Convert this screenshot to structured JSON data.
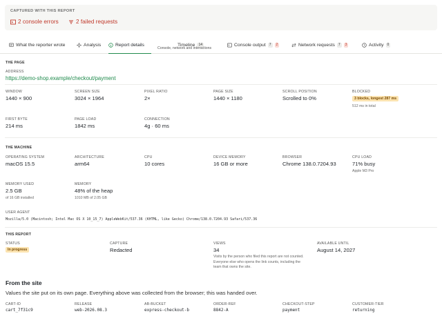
{
  "alert": {
    "title": "CAPTURED WITH THIS REPORT",
    "console_errors": "2 console errors",
    "failed_requests": "2 failed requests"
  },
  "tabs": [
    {
      "label": "What the reporter wrote",
      "icon": "message-icon"
    },
    {
      "label": "Analysis",
      "icon": "sparkle-icon"
    },
    {
      "label": "Report details",
      "icon": "info-icon",
      "active": true
    },
    {
      "label": "Timeline",
      "count": "14",
      "sub": "Console, network and interactions"
    },
    {
      "label": "Console output",
      "count": "7",
      "count_red": "2",
      "icon": "terminal-icon"
    },
    {
      "label": "Network requests",
      "count": "7",
      "count_red": "3",
      "icon": "network-icon"
    },
    {
      "label": "Activity",
      "count": "0",
      "icon": "activity-icon"
    }
  ],
  "page": {
    "section": "THE PAGE",
    "address_label": "ADDRESS",
    "address": "https://demo-shop.example/checkout/payment",
    "window_label": "WINDOW",
    "window": "1440 × 900",
    "screen_label": "SCREEN SIZE",
    "screen": "3024 × 1964",
    "pixel_label": "PIXEL RATIO",
    "pixel": "2×",
    "pagesize_label": "PAGE SIZE",
    "pagesize": "1440 × 1180",
    "scroll_label": "SCROLL POSITION",
    "scroll": "Scrolled to 0%",
    "blocked_label": "BLOCKED",
    "blocked_badge": "3 blocks, longest 287 ms",
    "blocked_sub": "512 ms in total",
    "firstbyte_label": "FIRST BYTE",
    "firstbyte": "214 ms",
    "pageload_label": "PAGE LOAD",
    "pageload": "1842 ms",
    "connection_label": "CONNECTION",
    "connection": "4g · 60 ms"
  },
  "machine": {
    "section": "THE MACHINE",
    "os_label": "OPERATING SYSTEM",
    "os": "macOS 15.5",
    "arch_label": "ARCHITECTURE",
    "arch": "arm64",
    "cpu_label": "CPU",
    "cpu": "10 cores",
    "devmem_label": "DEVICE MEMORY",
    "devmem": "16 GB or more",
    "browser_label": "BROWSER",
    "browser": "Chrome 138.0.7204.93",
    "cpuload_label": "CPU LOAD",
    "cpuload": "71% busy",
    "cpuload_sub": "Apple M3 Pro",
    "memused_label": "MEMORY USED",
    "memused": "2.5 GB",
    "memused_sub": "of 16 GB installed",
    "memory_label": "MEMORY",
    "memory": "48% of the heap",
    "memory_sub": "1010 MB of 2.05 GB",
    "ua_label": "USER AGENT",
    "ua": "Mozilla/5.0 (Macintosh; Intel Mac OS X 10_15_7) AppleWebKit/537.36 (KHTML, like Gecko) Chrome/138.0.7204.93 Safari/537.36"
  },
  "report": {
    "section": "THIS REPORT",
    "status_label": "STATUS",
    "status": "In progress",
    "capture_label": "CAPTURE",
    "capture": "Redacted",
    "views_label": "VIEWS",
    "views": "34",
    "views_note": "Visits by the person who filed this report are not counted. Everyone else who opens the link counts, including the team that owns the site.",
    "available_label": "AVAILABLE UNTIL",
    "available": "August 14, 2027"
  },
  "site": {
    "heading": "From the site",
    "desc": "Values the site put on its own page. Everything above was collected from the browser; this was handed over.",
    "fields": [
      {
        "label": "CART-ID",
        "value": "cart_7f31c9"
      },
      {
        "label": "RELEASE",
        "value": "web-2026.08.3"
      },
      {
        "label": "AB-BUCKET",
        "value": "express-checkout-b"
      },
      {
        "label": "ORDER-REF",
        "value": "8842-A"
      },
      {
        "label": "CHECKOUT-STEP",
        "value": "payment"
      },
      {
        "label": "CUSTOMER-TIER",
        "value": "returning"
      }
    ]
  },
  "colors": {
    "accent": "#1f8a4c",
    "error": "#c0392b",
    "warning_badge": "#fbe3b0"
  }
}
